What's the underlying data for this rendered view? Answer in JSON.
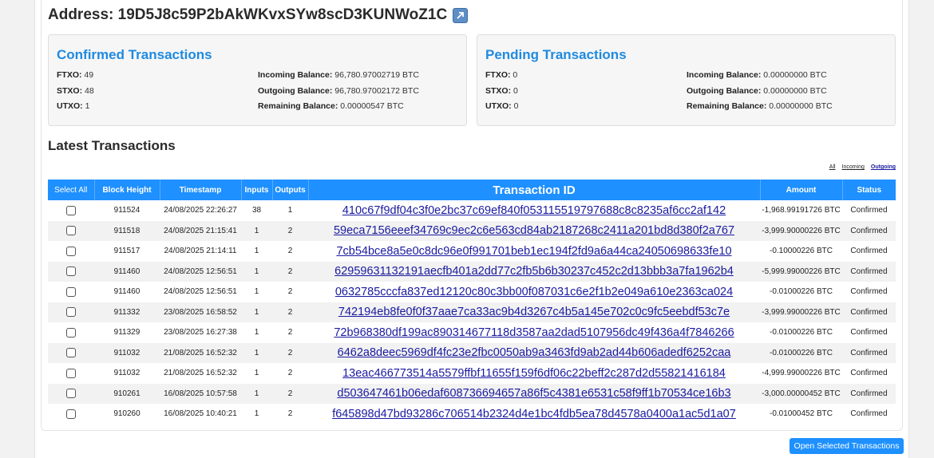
{
  "address": {
    "label": "Address:",
    "value": "19D5J8c59P2bAkWKvxSYw8scD3KUNWoZ1C",
    "icon": "external-link-icon"
  },
  "confirmed": {
    "title": "Confirmed Transactions",
    "ftxo_label": "FTXO:",
    "ftxo": "49",
    "stxo_label": "STXO:",
    "stxo": "48",
    "utxo_label": "UTXO:",
    "utxo": "1",
    "incoming_label": "Incoming Balance:",
    "incoming": "96,780.97002719 BTC",
    "outgoing_label": "Outgoing Balance:",
    "outgoing": "96,780.97002172 BTC",
    "remaining_label": "Remaining Balance:",
    "remaining": "0.00000547 BTC"
  },
  "pending": {
    "title": "Pending Transactions",
    "ftxo_label": "FTXO:",
    "ftxo": "0",
    "stxo_label": "STXO:",
    "stxo": "0",
    "utxo_label": "UTXO:",
    "utxo": "0",
    "incoming_label": "Incoming Balance:",
    "incoming": "0.00000000 BTC",
    "outgoing_label": "Outgoing Balance:",
    "outgoing": "0.00000000 BTC",
    "remaining_label": "Remaining Balance:",
    "remaining": "0.00000000 BTC"
  },
  "latest": {
    "title": "Latest Transactions",
    "filters": {
      "all": "All",
      "incoming": "Incoming",
      "outgoing": "Outgoing"
    },
    "columns": {
      "select": "Select All",
      "height": "Block Height",
      "timestamp": "Timestamp",
      "inputs": "Inputs",
      "outputs": "Outputs",
      "txid": "Transaction ID",
      "amount": "Amount",
      "status": "Status"
    },
    "rows": [
      {
        "height": "911524",
        "timestamp": "24/08/2025 22:26:27",
        "inputs": "38",
        "outputs": "1",
        "txid": "410c67f9df04c3f0e2bc37c69ef840f053115519797688c8c8235af6cc2af142",
        "amount": "-1,968.99191726 BTC",
        "status": "Confirmed"
      },
      {
        "height": "911518",
        "timestamp": "24/08/2025 21:15:41",
        "inputs": "1",
        "outputs": "2",
        "txid": "59eca7156eeef34769c9ec2c6e563cd84ab2187268c2411a201bd8d380f2a767",
        "amount": "-3,999.90000226 BTC",
        "status": "Confirmed"
      },
      {
        "height": "911517",
        "timestamp": "24/08/2025 21:14:11",
        "inputs": "1",
        "outputs": "2",
        "txid": "7cb54bce8a5e0c8dc96e0f991701beb1ec194f2fd9a6a44ca24050698633fe10",
        "amount": "-0.10000226 BTC",
        "status": "Confirmed"
      },
      {
        "height": "911460",
        "timestamp": "24/08/2025 12:56:51",
        "inputs": "1",
        "outputs": "2",
        "txid": "62959631132191aecfb401a2dd77c2fb5b6b30237c452c2d13bbb3a7fa1962b4",
        "amount": "-5,999.99000226 BTC",
        "status": "Confirmed"
      },
      {
        "height": "911460",
        "timestamp": "24/08/2025 12:56:51",
        "inputs": "1",
        "outputs": "2",
        "txid": "0632785cccfa837ed12120c80c3bb00f087031c6e2f1b2e049a610e2363ca024",
        "amount": "-0.01000226 BTC",
        "status": "Confirmed"
      },
      {
        "height": "911332",
        "timestamp": "23/08/2025 16:58:52",
        "inputs": "1",
        "outputs": "2",
        "txid": "742194eb8fe0f0f37aae7ca33ac9b4d3267c4b5a145e702c0c9fc5eebdf53c7e",
        "amount": "-3,999.99000226 BTC",
        "status": "Confirmed"
      },
      {
        "height": "911329",
        "timestamp": "23/08/2025 16:27:38",
        "inputs": "1",
        "outputs": "2",
        "txid": "72b968380df199ac890314677118d3587aa2dad5107956dc49f436a4f7846266",
        "amount": "-0.01000226 BTC",
        "status": "Confirmed"
      },
      {
        "height": "911032",
        "timestamp": "21/08/2025 16:52:32",
        "inputs": "1",
        "outputs": "2",
        "txid": "6462a8deec5969df4fc23e2fbc0050ab9a3463fd9ab2ad44b606adedf6252caa",
        "amount": "-0.01000226 BTC",
        "status": "Confirmed"
      },
      {
        "height": "911032",
        "timestamp": "21/08/2025 16:52:32",
        "inputs": "1",
        "outputs": "2",
        "txid": "13eac466773514a5579ffbf11655f159f6df06c22beff2c287d2d55821416184",
        "amount": "-4,999.99000226 BTC",
        "status": "Confirmed"
      },
      {
        "height": "910261",
        "timestamp": "16/08/2025 10:57:58",
        "inputs": "1",
        "outputs": "2",
        "txid": "d503647461b06edaf608736694657a86f5c4381e6531c58f9ff1b70534ce16b3",
        "amount": "-3,000.00000452 BTC",
        "status": "Confirmed"
      },
      {
        "height": "910260",
        "timestamp": "16/08/2025 10:40:21",
        "inputs": "1",
        "outputs": "2",
        "txid": "f645898d47bd93286c706514b2324d4e1bc4fdb5ea78d4578a0400a1ac5d1a07",
        "amount": "-0.01000452 BTC",
        "status": "Confirmed"
      }
    ]
  },
  "open_button": "Open Selected Transactions",
  "colors": {
    "accent": "#1e90ff",
    "title_blue": "#1f8ae0",
    "link": "#1a1aa0"
  }
}
